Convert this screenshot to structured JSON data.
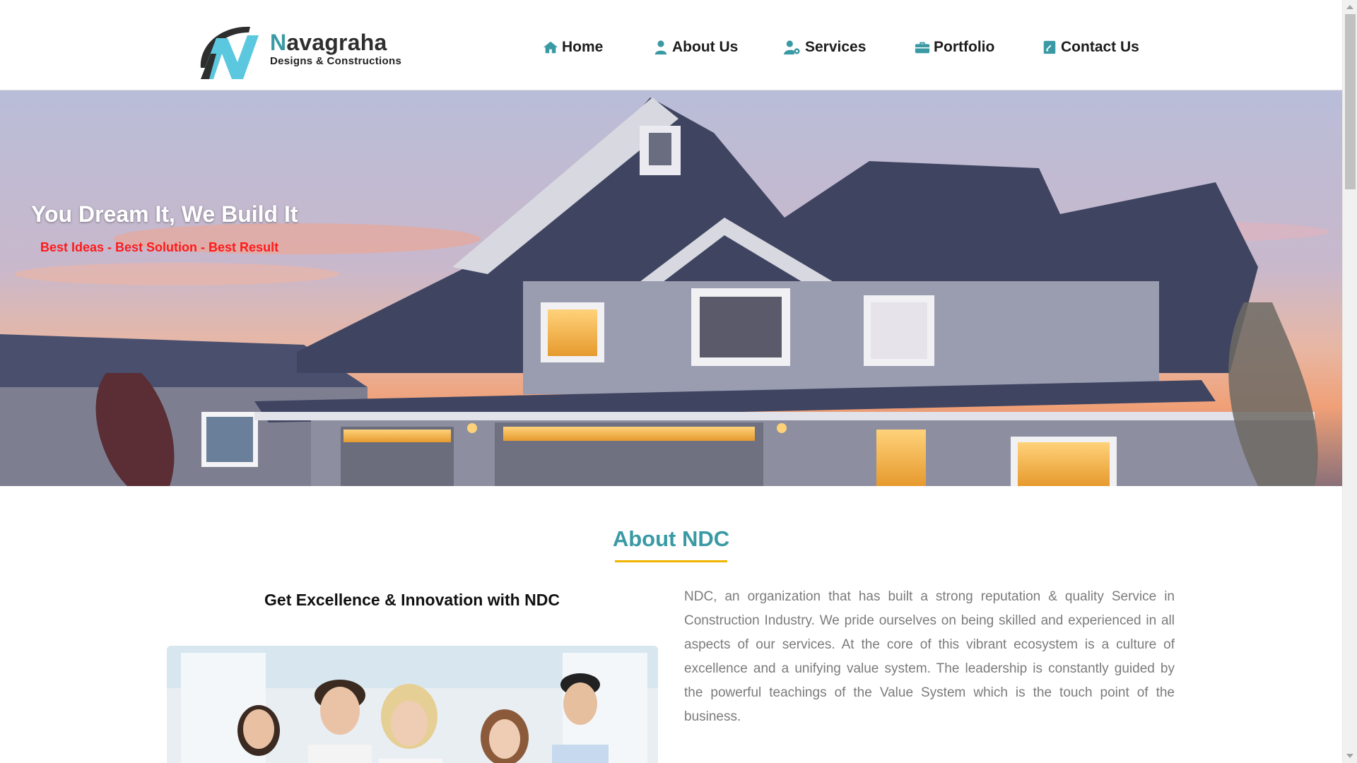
{
  "brand": {
    "name_first_letter": "N",
    "name_rest": "avagraha",
    "tagline": "Designs & Constructions",
    "colors": {
      "accent": "#3a9aa4",
      "logo_blue": "#5bc8df",
      "logo_dark": "#2e2e2e"
    }
  },
  "nav": {
    "items": [
      {
        "label": "Home",
        "icon": "home-icon"
      },
      {
        "label": "About Us",
        "icon": "user-icon"
      },
      {
        "label": "Services",
        "icon": "user-gear-icon"
      },
      {
        "label": "Portfolio",
        "icon": "briefcase-icon"
      },
      {
        "label": "Contact Us",
        "icon": "contact-card-icon"
      }
    ]
  },
  "hero": {
    "title": "You Dream It, We Build It",
    "subtitle": "Best Ideas - Best Solution - Best Result",
    "subtitle_color": "#ff1a1a",
    "image": "house-at-dusk"
  },
  "about": {
    "heading": "About NDC",
    "heading_underline_color": "#f0b400",
    "left_title": "Get Excellence & Innovation with NDC",
    "image": "team-photo",
    "body": "NDC, an organization that has built a strong reputation & quality Service in Construction Industry. We pride ourselves on being skilled and experienced in all aspects of our services. At the core of this vibrant ecosystem is a culture of excellence and a unifying value system. The leadership is constantly guided by the powerful teachings of the Value System which is the touch point of the business."
  }
}
